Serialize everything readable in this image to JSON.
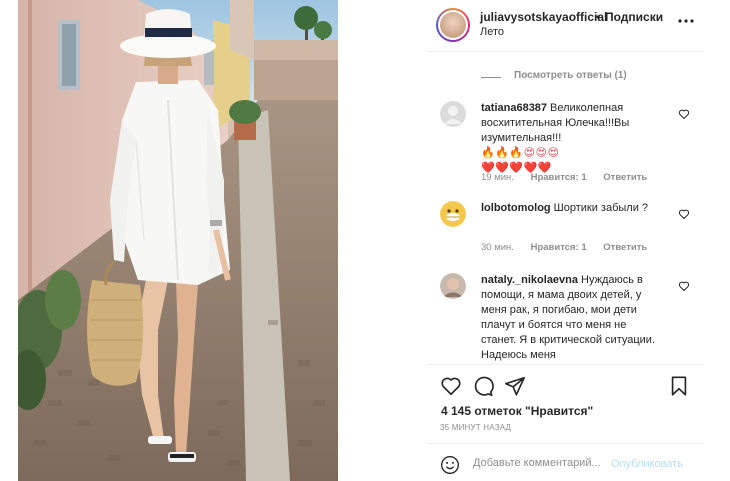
{
  "post": {
    "username": "juliavysotskayaofficial",
    "dot": "•",
    "follow_label": "Подписки",
    "location": "Лето",
    "more_icon": "more-horizontal-icon"
  },
  "replies": {
    "view_label": "Посмотреть ответы (1)"
  },
  "comments": [
    {
      "username": "tatiana68387",
      "text": "Великолепная восхитительная Юлечка!!!Вы изумительная!!!",
      "emojis_line1": "🔥🔥🔥😍😍😍",
      "emojis_line2": "❤️❤️❤️❤️❤️",
      "time": "19 мин.",
      "likes": "Нравится: 1",
      "reply": "Ответить"
    },
    {
      "username": "lolbotomolog",
      "text": "Шортики забыли ?",
      "time": "30 мин.",
      "likes": "Нравится: 1",
      "reply": "Ответить"
    },
    {
      "username": "nataly._nikolaevna",
      "text": "Нуждаюсь в помощи, я мама двоих детей, у меня рак, я погибаю, мои дети плачут и боятся что меня не станет. Я в критической ситуации. Надеюсь меня"
    }
  ],
  "actions": {
    "likes_text": "4 145 отметок \"Нравится\"",
    "time_ago": "35 МИНУТ НАЗАД"
  },
  "add_comment": {
    "placeholder": "Добавьте комментарий...",
    "post_label": "Опубликовать"
  },
  "colors": {
    "text": "#262626",
    "muted": "#8e8e8e",
    "post_disabled": "#b2dffc",
    "heart_red": "#ed4956"
  }
}
